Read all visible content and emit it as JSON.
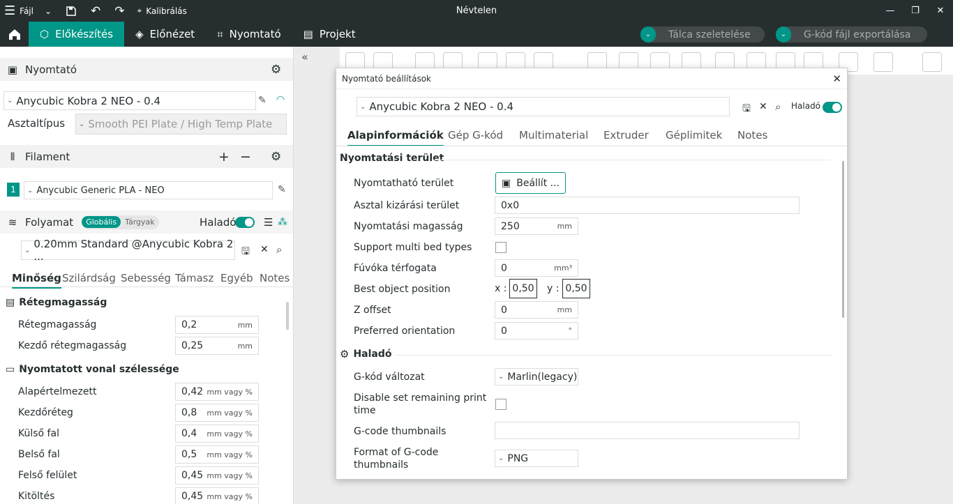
{
  "titlebar": {
    "menu_label": "Fájl",
    "calibration_label": "Kalibrálás",
    "window_title": "Névtelen"
  },
  "tabs": {
    "prepare": "Előkészítés",
    "preview": "Előnézet",
    "printer": "Nyomtató",
    "project": "Projekt"
  },
  "actions": {
    "slice_plate": "Tálca szeletelése",
    "export_gcode": "G-kód fájl exportálása"
  },
  "left": {
    "printer_header": "Nyomtató",
    "printer_name": "Anycubic Kobra 2 NEO - 0.4",
    "bed_type_label": "Asztaltípus",
    "bed_type_value": "Smooth PEI Plate / High Temp Plate",
    "filament_header": "Filament",
    "filament_index": "1",
    "filament_name": "Anycubic Generic PLA - NEO",
    "process_header": "Folyamat",
    "process_global": "Globális",
    "process_objects": "Tárgyak",
    "advanced_label": "Haladó",
    "process_preset": "0.20mm Standard @Anycubic Kobra 2 ...",
    "subtabs": [
      "Minőség",
      "Szilárdság",
      "Sebesség",
      "Támasz",
      "Egyéb",
      "Notes"
    ],
    "layer_group": "Rétegmagasság",
    "layer_rows": [
      {
        "label": "Rétegmagasság",
        "value": "0,2",
        "unit": "mm"
      },
      {
        "label": "Kezdő rétegmagasság",
        "value": "0,25",
        "unit": "mm"
      }
    ],
    "width_group": "Nyomtatott vonal szélessége",
    "width_rows": [
      {
        "label": "Alapértelmezett",
        "value": "0,42",
        "unit": "mm vagy %"
      },
      {
        "label": "Kezdőréteg",
        "value": "0,8",
        "unit": "mm vagy %"
      },
      {
        "label": "Külső fal",
        "value": "0,4",
        "unit": "mm vagy %"
      },
      {
        "label": "Belső fal",
        "value": "0,5",
        "unit": "mm vagy %"
      },
      {
        "label": "Felső felület",
        "value": "0,45",
        "unit": "mm vagy %"
      },
      {
        "label": "Kitöltés",
        "value": "0,45",
        "unit": "mm vagy %"
      }
    ]
  },
  "dialog": {
    "title": "Nyomtató beállítások",
    "preset": "Anycubic Kobra 2 NEO - 0.4",
    "advanced_label": "Haladó",
    "tabs": [
      "Alapinformációk",
      "Gép G-kód",
      "Multimaterial",
      "Extruder",
      "Géplimitek",
      "Notes"
    ],
    "area_group": "Nyomtatási terület",
    "printable_area_label": "Nyomtatható terület",
    "printable_area_button": "Beállít ...",
    "exclude_label": "Asztal kizárási terület",
    "exclude_value": "0x0",
    "height_label": "Nyomtatási magasság",
    "height_value": "250",
    "height_unit": "mm",
    "multibed_label": "Support multi bed types",
    "nozzle_volume_label": "Fúvóka térfogata",
    "nozzle_volume_value": "0",
    "nozzle_volume_unit": "mm³",
    "best_pos_label": "Best object position",
    "best_pos_x_label": "x :",
    "best_pos_x": "0,50",
    "best_pos_y_label": "y :",
    "best_pos_y": "0,50",
    "zoffset_label": "Z offset",
    "zoffset_value": "0",
    "zoffset_unit": "mm",
    "orientation_label": "Preferred orientation",
    "orientation_value": "0",
    "orientation_unit": "°",
    "advanced_group": "Haladó",
    "gcode_flavor_label": "G-kód változat",
    "gcode_flavor_value": "Marlin(legacy)",
    "disable_remaining_label": "Disable set remaining print time",
    "thumbnails_label": "G-code thumbnails",
    "thumbnails_value": "",
    "thumb_format_label": "Format of G-code thumbnails",
    "thumb_format_value": "PNG"
  },
  "colors": {
    "accent": "#009688",
    "dark": "#262e30"
  }
}
